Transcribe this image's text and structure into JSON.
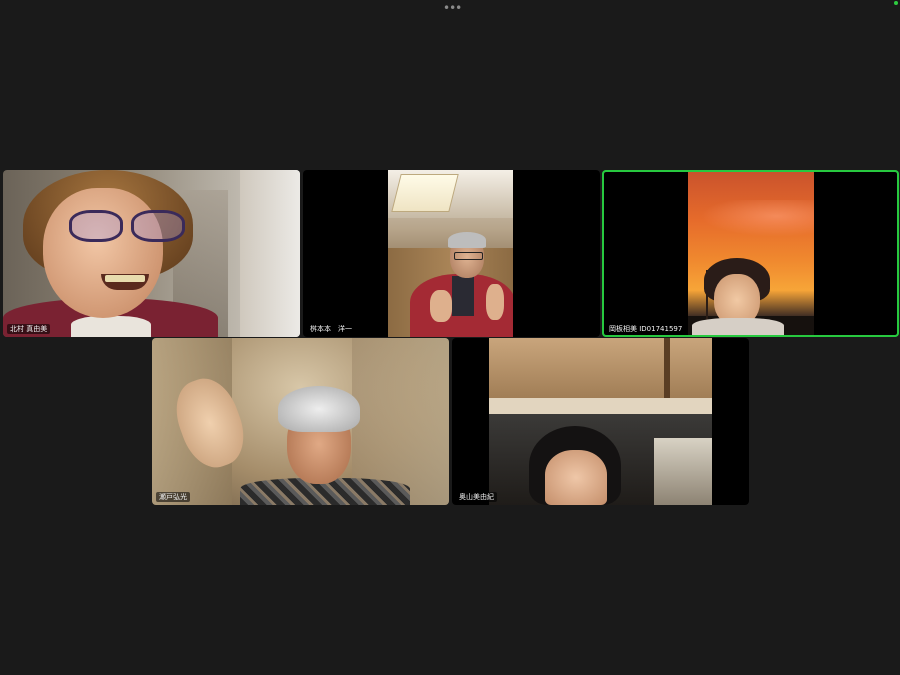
{
  "topbar": {
    "more_icon": "more-options-icon",
    "more_glyph": "•••"
  },
  "participants": [
    {
      "name": "北村 真由美",
      "active": false
    },
    {
      "name": "桝本本　洋一",
      "active": false
    },
    {
      "name": "岡板相美 ID01741597",
      "active": true
    },
    {
      "name": "瀬戸弘光",
      "active": false
    },
    {
      "name": "奥山美由紀",
      "active": false
    }
  ],
  "colors": {
    "active_speaker_border": "#27c93f",
    "background": "#1a1a1a"
  }
}
